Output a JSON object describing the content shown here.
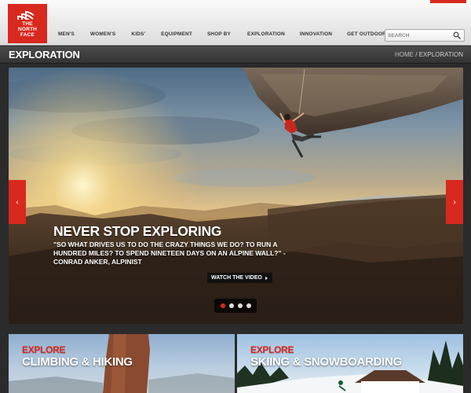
{
  "brand": {
    "logo_lines": [
      "THE",
      "NORTH",
      "FACE"
    ],
    "accent_color": "#d9281d"
  },
  "nav": {
    "items": [
      {
        "label": "MEN'S"
      },
      {
        "label": "WOMEN'S"
      },
      {
        "label": "KIDS'"
      },
      {
        "label": "EQUIPMENT"
      },
      {
        "label": "SHOP BY"
      },
      {
        "label": "EXPLORATION"
      },
      {
        "label": "INNOVATION"
      },
      {
        "label": "GET OUTDOORS"
      }
    ]
  },
  "search": {
    "placeholder": "SEARCH",
    "icon": "magnifier-icon"
  },
  "titlebar": {
    "title": "EXPLORATION",
    "breadcrumb_home": "HOME",
    "breadcrumb_sep": " / ",
    "breadcrumb_current": "EXPLORATION"
  },
  "hero": {
    "heading": "NEVER STOP EXPLORING",
    "quote": "\"SO WHAT DRIVES US TO DO THE CRAZY THINGS WE DO? TO RUN A HUNDRED MILES? TO SPEND NINETEEN DAYS ON AN ALPINE WALL?\" - CONRAD ANKER, ALPINIST",
    "cta": "WATCH THE VIDEO",
    "prev_arrow": "‹",
    "next_arrow": "›",
    "slides_total": 4,
    "active_slide": 1
  },
  "tiles": [
    {
      "kicker": "EXPLORE",
      "label": "CLIMBING & HIKING"
    },
    {
      "kicker": "EXPLORE",
      "label": "SKIING & SNOWBOARDING"
    }
  ]
}
